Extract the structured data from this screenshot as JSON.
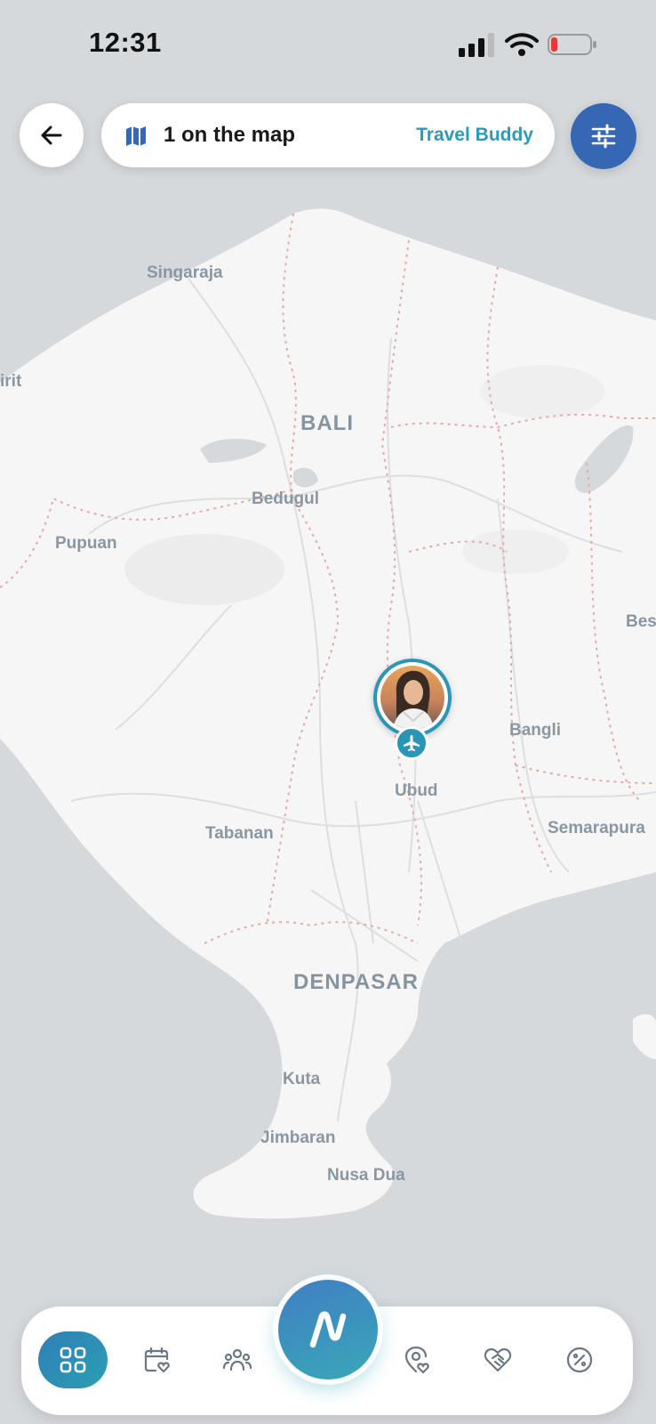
{
  "status_bar": {
    "time": "12:31"
  },
  "header": {
    "map_count": "1 on the map",
    "mode_label": "Travel Buddy"
  },
  "map": {
    "places": {
      "singaraja": "Singaraja",
      "bali": "BALI",
      "bedugul": "Bedugul",
      "pupuan": "Pupuan",
      "bangli": "Bangli",
      "ubud": "Ubud",
      "tabanan": "Tabanan",
      "semarapura": "Semarapura",
      "denpasar": "DENPASAR",
      "kuta": "Kuta",
      "jimbaran": "Jimbaran",
      "nusa_dua": "Nusa Dua",
      "left_edge": "irit",
      "right_edge": "Bes"
    }
  },
  "colors": {
    "accent": "#2a9bbd",
    "filter_button": "#3567b5",
    "marker_ring": "#2b95b7",
    "map_water": "#d5d9dc",
    "map_land": "#f5f5f5",
    "border_dotted": "#e0a8a8"
  },
  "icons": {
    "back": "arrow-left-icon",
    "map": "map-icon",
    "filter": "sliders-icon",
    "plane": "plane-icon",
    "nav": [
      "grid-icon",
      "calendar-heart-icon",
      "people-icon",
      "logo-icon",
      "location-heart-icon",
      "handshake-heart-icon",
      "percent-badge-icon"
    ]
  }
}
